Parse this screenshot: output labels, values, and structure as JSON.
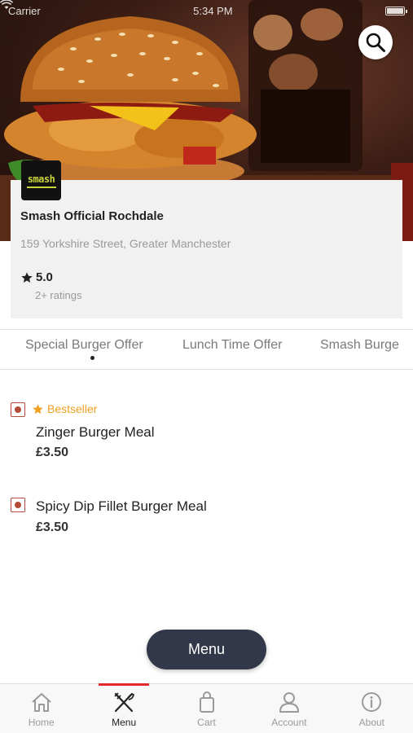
{
  "status_bar": {
    "carrier": "Carrier",
    "time": "5:34 PM"
  },
  "store": {
    "logo_text": "smash",
    "name": "Smash Official Rochdale",
    "address": "159 Yorkshire Street, Greater Manchester",
    "rating": "5.0",
    "ratings_count": "2+ ratings"
  },
  "tabs": [
    {
      "label": "Special Burger Offer",
      "active": true
    },
    {
      "label": "Lunch Time Offer",
      "active": false
    },
    {
      "label": "Smash Burge",
      "active": false
    }
  ],
  "items": [
    {
      "badge": "Bestseller",
      "name": "Zinger Burger Meal",
      "price": "£3.50"
    },
    {
      "badge": "",
      "name": "Spicy Dip Fillet Burger Meal",
      "price": "£3.50"
    }
  ],
  "menu_button": {
    "label": "Menu"
  },
  "bottom_nav": [
    {
      "label": "Home",
      "icon": "home-icon",
      "active": false
    },
    {
      "label": "Menu",
      "icon": "fork-knife-icon",
      "active": true
    },
    {
      "label": "Cart",
      "icon": "bag-icon",
      "active": false
    },
    {
      "label": "Account",
      "icon": "person-icon",
      "active": false
    },
    {
      "label": "About",
      "icon": "info-icon",
      "active": false
    }
  ],
  "colors": {
    "accent": "#e02a2a",
    "bestseller": "#f0a020",
    "veg_marker": "#b34a3a",
    "menu_pill": "#323849"
  }
}
